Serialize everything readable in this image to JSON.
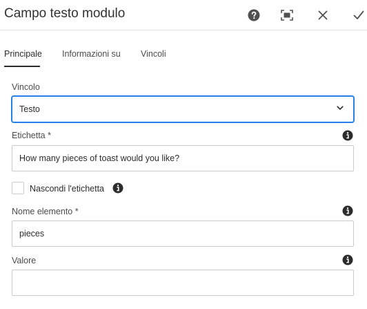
{
  "dialog": {
    "title": "Campo testo modulo",
    "help_icon": "help-circle-icon",
    "fullscreen_icon": "fullscreen-icon",
    "close_icon": "close-icon",
    "confirm_icon": "checkmark-icon"
  },
  "tabs": [
    {
      "label": "Principale",
      "active": true
    },
    {
      "label": "Informazioni su",
      "active": false
    },
    {
      "label": "Vincoli",
      "active": false
    }
  ],
  "form": {
    "constraint": {
      "label": "Vincolo",
      "value": "Testo",
      "icon": "chevron-down-icon"
    },
    "caption": {
      "label": "Etichetta *",
      "value": "How many pieces of toast would you like?",
      "icon": "info-icon"
    },
    "hide_caption": {
      "label": "Nascondi l'etichetta",
      "checked": false,
      "icon": "info-icon"
    },
    "element_name": {
      "label": "Nome elemento *",
      "value": "pieces",
      "icon": "info-icon"
    },
    "value": {
      "label": "Valore",
      "value": "",
      "icon": "info-icon"
    }
  },
  "colors": {
    "accent": "#2680eb",
    "text": "#2c2c2c",
    "border": "#cacaca",
    "icon": "#323232"
  }
}
